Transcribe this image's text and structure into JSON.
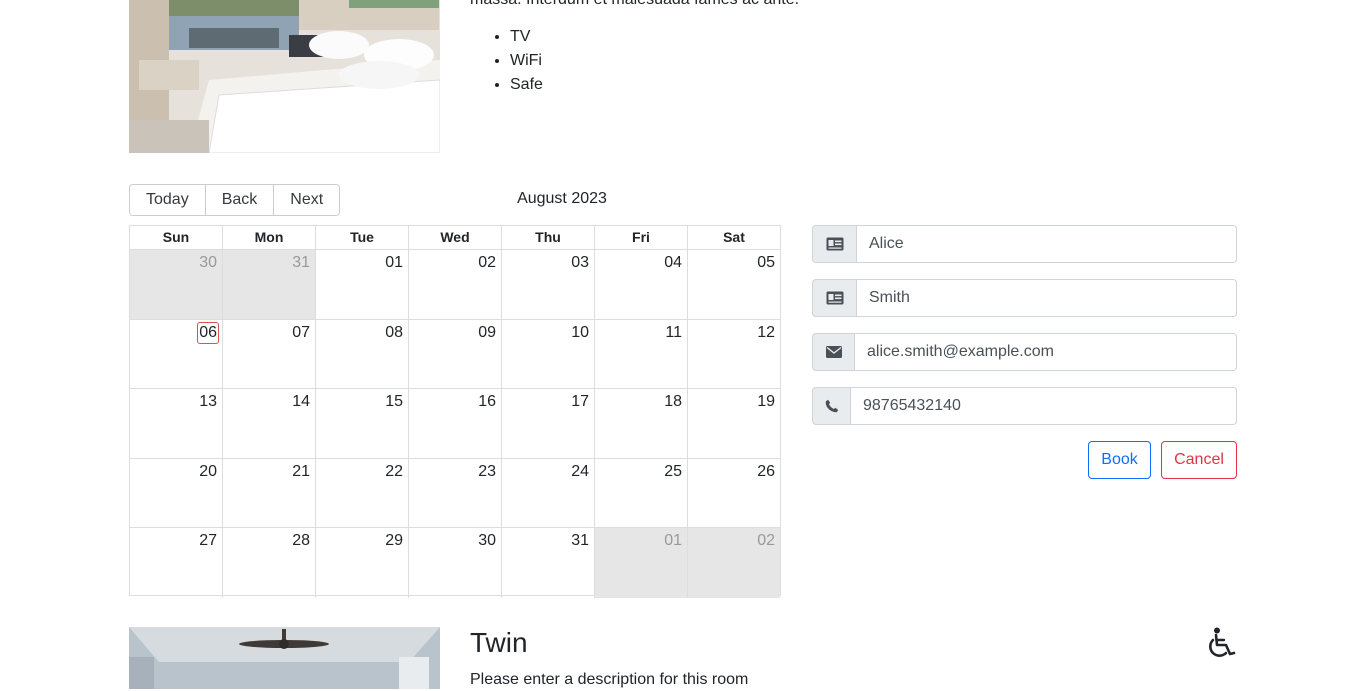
{
  "room1": {
    "description_clip": "massa. Interdum et malesuada fames ac ante.",
    "amenities": [
      "TV",
      "WiFi",
      "Safe"
    ]
  },
  "toolbar": {
    "today": "Today",
    "back": "Back",
    "next": "Next",
    "month_label": "August 2023"
  },
  "calendar": {
    "weekdays": [
      "Sun",
      "Mon",
      "Tue",
      "Wed",
      "Thu",
      "Fri",
      "Sat"
    ],
    "weeks": [
      [
        "30",
        "31",
        "01",
        "02",
        "03",
        "04",
        "05"
      ],
      [
        "06",
        "07",
        "08",
        "09",
        "10",
        "11",
        "12"
      ],
      [
        "13",
        "14",
        "15",
        "16",
        "17",
        "18",
        "19"
      ],
      [
        "20",
        "21",
        "22",
        "23",
        "24",
        "25",
        "26"
      ],
      [
        "27",
        "28",
        "29",
        "30",
        "31",
        "01",
        "02"
      ]
    ],
    "today": "06",
    "highlight_color": "#d9534f",
    "off_range_color": "#e6e6e6"
  },
  "form": {
    "firstname": "Alice",
    "lastname": "Smith",
    "email": "alice.smith@example.com",
    "phone": "98765432140",
    "book_label": "Book",
    "cancel_label": "Cancel",
    "book_color": "#0d6efd",
    "cancel_color": "#dc3545"
  },
  "room2": {
    "title": "Twin",
    "description": "Please enter a description for this room"
  }
}
